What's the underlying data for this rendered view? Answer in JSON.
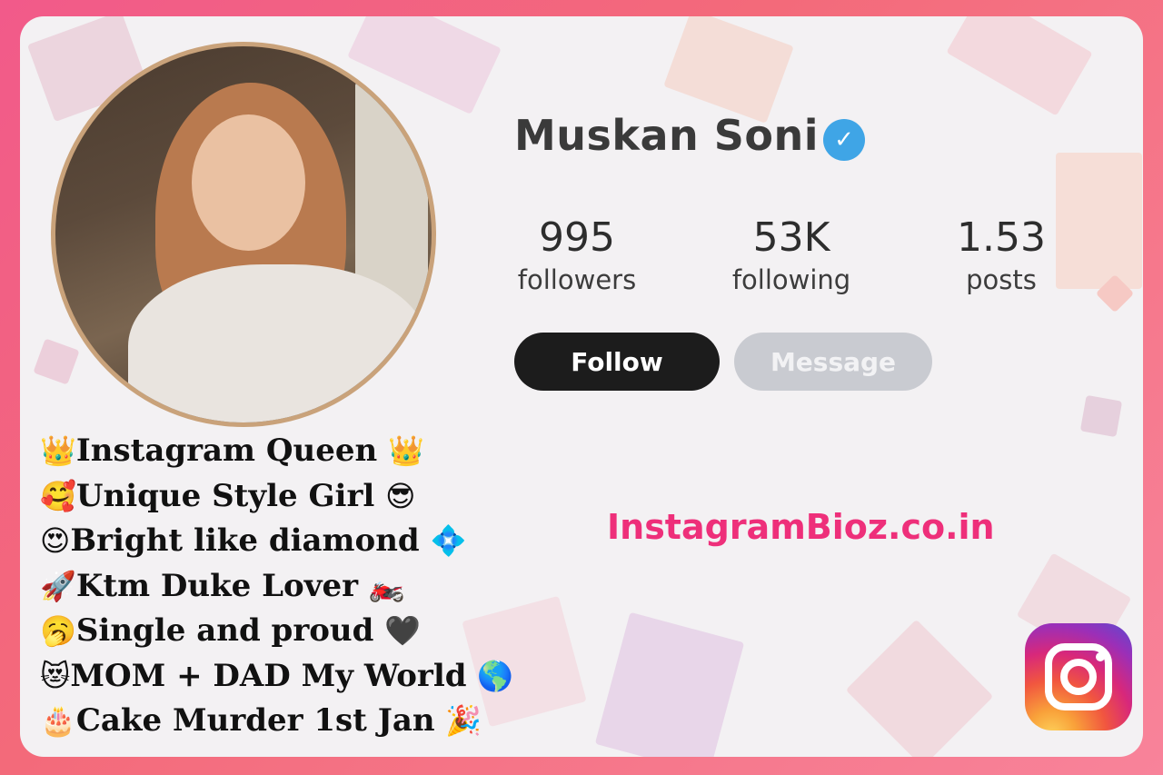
{
  "profile": {
    "name": "Muskan Soni",
    "verified_icon": "verified-badge-icon"
  },
  "stats": [
    {
      "value": "995",
      "label": "followers"
    },
    {
      "value": "53K",
      "label": "following"
    },
    {
      "value": "1.53",
      "label": "posts"
    }
  ],
  "buttons": {
    "follow": "Follow",
    "message": "Message"
  },
  "website": "InstagramBioz.co.in",
  "bio": [
    {
      "pre": "👑",
      "text": "Instagram Queen",
      "post": "👑"
    },
    {
      "pre": "🥰",
      "text": "Unique Style Girl",
      "post": "😎"
    },
    {
      "pre": "😍",
      "text": "Bright like diamond",
      "post": "💠"
    },
    {
      "pre": "🚀",
      "text": "Ktm Duke Lover",
      "post": "🏍️"
    },
    {
      "pre": "🥱",
      "text": "Single and proud",
      "post": "🖤"
    },
    {
      "pre": "😻",
      "text": "MOM + DAD My World",
      "post": "🌎"
    },
    {
      "pre": "🎂",
      "text": "Cake Murder 1st Jan",
      "post": "🎉"
    }
  ],
  "colors": {
    "frame": "#f25a8a",
    "accent_pink": "#ee2f7a",
    "verified_blue": "#3fa5e6",
    "follow_button": "#1c1c1c",
    "message_button": "#c9cbd1"
  }
}
